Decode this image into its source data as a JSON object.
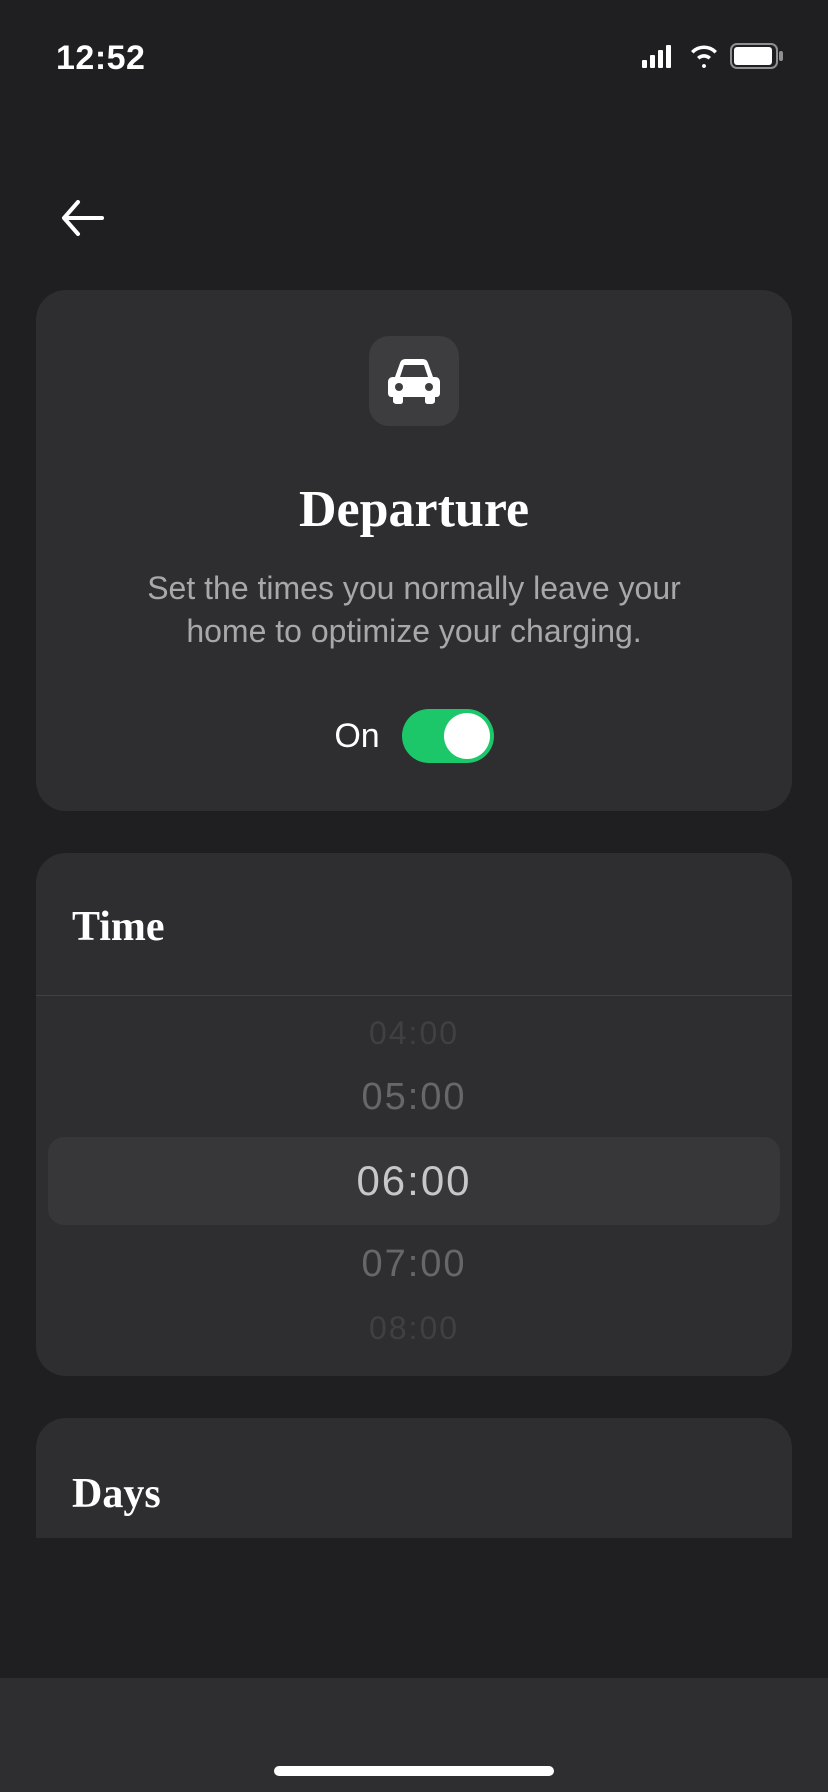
{
  "status": {
    "time": "12:52"
  },
  "header": {
    "title": "Departure",
    "description": "Set the times you normally leave your home to optimize your charging.",
    "icon": "car-icon"
  },
  "toggle": {
    "label": "On",
    "state": true
  },
  "time_section": {
    "title": "Time",
    "options": [
      "04:00",
      "05:00",
      "06:00",
      "07:00",
      "08:00"
    ],
    "selected": "06:00"
  },
  "days_section": {
    "title": "Days"
  }
}
